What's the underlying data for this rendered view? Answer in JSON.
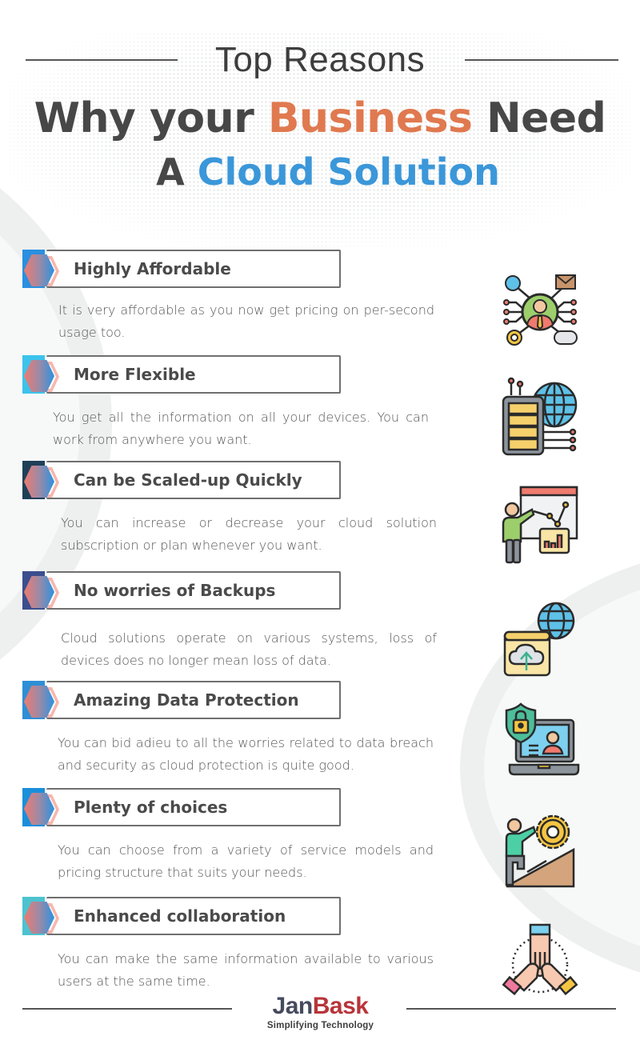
{
  "header": {
    "top_label": "Top Reasons",
    "title_line1_part1": "Why your ",
    "title_line1_accent": "Business",
    "title_line1_part2": " Need",
    "title_line2_part1": "A ",
    "title_line2_accent": "Cloud Solution"
  },
  "colors": {
    "accent_orange": "#e0794f",
    "accent_blue": "#3b97d9",
    "text_dark": "#474747",
    "logo_jan": "#464a5e",
    "logo_bask": "#b8343a"
  },
  "reasons": [
    {
      "title": "Highly Affordable",
      "description": "It is very affordable as you now get pricing on per-second usage too.",
      "strip_color": "#2a8fe0",
      "icon": "customer-network-icon"
    },
    {
      "title": "More Flexible",
      "description": "You get all the information on all your devices. You can work from anywhere you want.",
      "strip_color": "#3cc3ec",
      "icon": "server-globe-icon"
    },
    {
      "title": "Can be Scaled-up Quickly",
      "description": "You can increase or decrease your cloud solution subscription or plan whenever you want.",
      "strip_color": "#1f3f58",
      "icon": "presentation-chart-icon"
    },
    {
      "title": "No worries of Backups",
      "description": "Cloud solutions operate on various systems, loss of devices does no longer mean loss of data.",
      "strip_color": "#3b4e8e",
      "icon": "cloud-upload-globe-icon"
    },
    {
      "title": "Amazing Data Protection",
      "description": "You can bid adieu to all the worries related to data breach and security as cloud protection is quite good.",
      "strip_color": "#2d8fd5",
      "icon": "shield-laptop-icon"
    },
    {
      "title": "Plenty of choices",
      "description": "You can choose from a variety of service models and pricing structure that suits your needs.",
      "strip_color": "#1a8fdb",
      "icon": "climber-gear-icon"
    },
    {
      "title": "Enhanced collaboration",
      "description": "You can make the same information available to various users at the same time.",
      "strip_color": "#4cc3d0",
      "icon": "teamwork-hands-icon"
    }
  ],
  "footer": {
    "logo_part1": "Jan",
    "logo_part2": "Bask",
    "tagline": "Simplifying Technology"
  }
}
